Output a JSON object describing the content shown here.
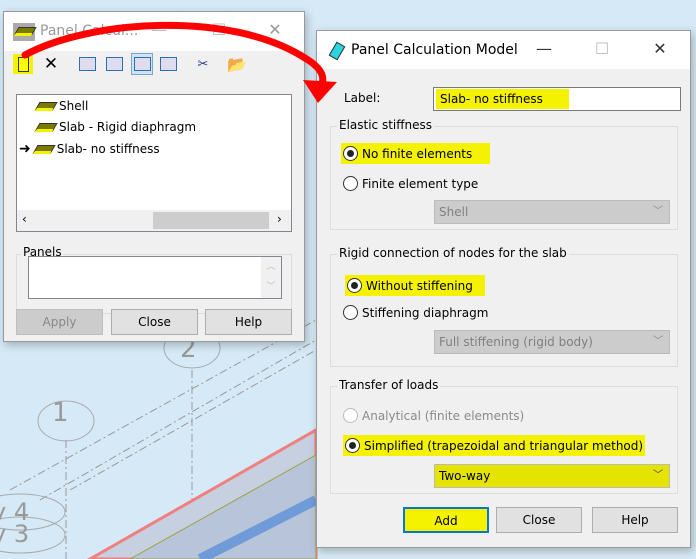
{
  "background": {
    "grid_labels": [
      "1",
      "2",
      "y 4",
      "y 3"
    ]
  },
  "left_dialog": {
    "title": "Panel Calcul...",
    "toolbar": [
      "new-icon",
      "delete-icon",
      "view1-icon",
      "view2-icon",
      "view3-icon",
      "view4-icon",
      "cut-icon",
      "open-folder-icon"
    ],
    "tree": [
      {
        "label": "Shell",
        "current": false
      },
      {
        "label": "Slab - Rigid diaphragm",
        "current": false
      },
      {
        "label": "Slab- no stiffness",
        "current": true
      }
    ],
    "panels_label": "Panels",
    "panels_value": "",
    "buttons": {
      "apply": "Apply",
      "close": "Close",
      "help": "Help"
    }
  },
  "right_dialog": {
    "title": "Panel Calculation Model",
    "label_caption": "Label:",
    "label_value": "Slab- no stiffness",
    "elastic": {
      "title": "Elastic stiffness",
      "opt1": "No finite elements",
      "opt2": "Finite element type",
      "select": "Shell",
      "selected": "No finite elements"
    },
    "rigid": {
      "title": "Rigid connection of nodes for the slab",
      "opt1": "Without stiffening",
      "opt2": "Stiffening diaphragm",
      "select": "Full stiffening (rigid body)",
      "selected": "Without stiffening"
    },
    "transfer": {
      "title": "Transfer of loads",
      "opt1": "Analytical (finite elements)",
      "opt2": "Simplified (trapezoidal and triangular method)",
      "select": "Two-way",
      "selected": "Simplified (trapezoidal and triangular method)"
    },
    "buttons": {
      "add": "Add",
      "close": "Close",
      "help": "Help"
    }
  },
  "colors": {
    "highlight": "#f5f200",
    "annotation": "#ff0000",
    "focus": "#0078d7"
  }
}
